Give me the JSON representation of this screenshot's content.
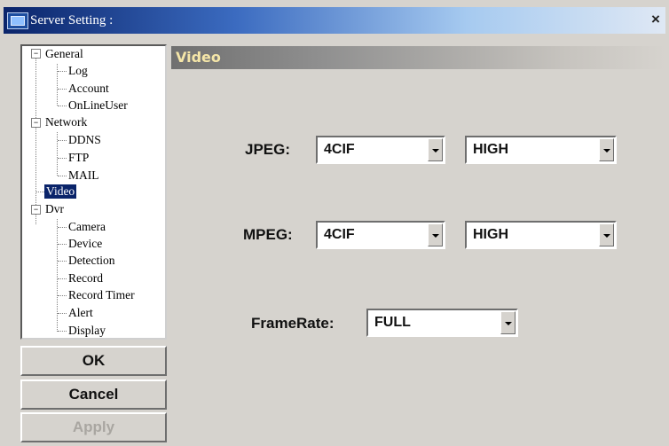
{
  "window": {
    "title": "Server Setting :",
    "close_glyph": "×"
  },
  "tree": {
    "general": {
      "label": "General",
      "expander": "−",
      "children": [
        "Log",
        "Account",
        "OnLineUser"
      ]
    },
    "network": {
      "label": "Network",
      "expander": "−",
      "children": [
        "DDNS",
        "FTP",
        "MAIL"
      ]
    },
    "video": {
      "label": "Video",
      "selected": true
    },
    "dvr": {
      "label": "Dvr",
      "expander": "−",
      "children": [
        "Camera",
        "Device",
        "Detection",
        "Record",
        "Record Timer",
        "Alert",
        "Display"
      ]
    }
  },
  "buttons": {
    "ok": "OK",
    "cancel": "Cancel",
    "apply": "Apply"
  },
  "section": {
    "title": "Video"
  },
  "settings": {
    "jpeg": {
      "label": "JPEG:",
      "resolution": "4CIF",
      "quality": "HIGH"
    },
    "mpeg": {
      "label": "MPEG:",
      "resolution": "4CIF",
      "quality": "HIGH"
    },
    "framerate": {
      "label": "FrameRate:",
      "value": "FULL"
    }
  },
  "colors": {
    "title_bar": "#0a246a",
    "selection": "#0a246a",
    "section_title": "#f5e6a8",
    "face": "#d6d3ce"
  },
  "icons": {
    "window": "app-window-icon",
    "close": "close-icon",
    "dropdown": "dropdown-arrow-icon"
  }
}
